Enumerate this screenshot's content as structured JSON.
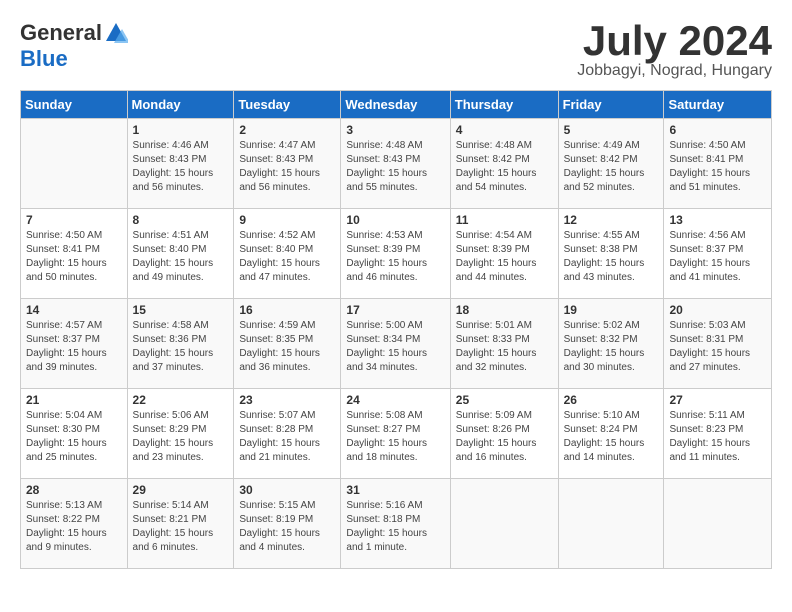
{
  "logo": {
    "general": "General",
    "blue": "Blue"
  },
  "title": "July 2024",
  "subtitle": "Jobbagyi, Nograd, Hungary",
  "days_of_week": [
    "Sunday",
    "Monday",
    "Tuesday",
    "Wednesday",
    "Thursday",
    "Friday",
    "Saturday"
  ],
  "weeks": [
    [
      {
        "day": "",
        "sunrise": "",
        "sunset": "",
        "daylight": ""
      },
      {
        "day": "1",
        "sunrise": "Sunrise: 4:46 AM",
        "sunset": "Sunset: 8:43 PM",
        "daylight": "Daylight: 15 hours and 56 minutes."
      },
      {
        "day": "2",
        "sunrise": "Sunrise: 4:47 AM",
        "sunset": "Sunset: 8:43 PM",
        "daylight": "Daylight: 15 hours and 56 minutes."
      },
      {
        "day": "3",
        "sunrise": "Sunrise: 4:48 AM",
        "sunset": "Sunset: 8:43 PM",
        "daylight": "Daylight: 15 hours and 55 minutes."
      },
      {
        "day": "4",
        "sunrise": "Sunrise: 4:48 AM",
        "sunset": "Sunset: 8:42 PM",
        "daylight": "Daylight: 15 hours and 54 minutes."
      },
      {
        "day": "5",
        "sunrise": "Sunrise: 4:49 AM",
        "sunset": "Sunset: 8:42 PM",
        "daylight": "Daylight: 15 hours and 52 minutes."
      },
      {
        "day": "6",
        "sunrise": "Sunrise: 4:50 AM",
        "sunset": "Sunset: 8:41 PM",
        "daylight": "Daylight: 15 hours and 51 minutes."
      }
    ],
    [
      {
        "day": "7",
        "sunrise": "Sunrise: 4:50 AM",
        "sunset": "Sunset: 8:41 PM",
        "daylight": "Daylight: 15 hours and 50 minutes."
      },
      {
        "day": "8",
        "sunrise": "Sunrise: 4:51 AM",
        "sunset": "Sunset: 8:40 PM",
        "daylight": "Daylight: 15 hours and 49 minutes."
      },
      {
        "day": "9",
        "sunrise": "Sunrise: 4:52 AM",
        "sunset": "Sunset: 8:40 PM",
        "daylight": "Daylight: 15 hours and 47 minutes."
      },
      {
        "day": "10",
        "sunrise": "Sunrise: 4:53 AM",
        "sunset": "Sunset: 8:39 PM",
        "daylight": "Daylight: 15 hours and 46 minutes."
      },
      {
        "day": "11",
        "sunrise": "Sunrise: 4:54 AM",
        "sunset": "Sunset: 8:39 PM",
        "daylight": "Daylight: 15 hours and 44 minutes."
      },
      {
        "day": "12",
        "sunrise": "Sunrise: 4:55 AM",
        "sunset": "Sunset: 8:38 PM",
        "daylight": "Daylight: 15 hours and 43 minutes."
      },
      {
        "day": "13",
        "sunrise": "Sunrise: 4:56 AM",
        "sunset": "Sunset: 8:37 PM",
        "daylight": "Daylight: 15 hours and 41 minutes."
      }
    ],
    [
      {
        "day": "14",
        "sunrise": "Sunrise: 4:57 AM",
        "sunset": "Sunset: 8:37 PM",
        "daylight": "Daylight: 15 hours and 39 minutes."
      },
      {
        "day": "15",
        "sunrise": "Sunrise: 4:58 AM",
        "sunset": "Sunset: 8:36 PM",
        "daylight": "Daylight: 15 hours and 37 minutes."
      },
      {
        "day": "16",
        "sunrise": "Sunrise: 4:59 AM",
        "sunset": "Sunset: 8:35 PM",
        "daylight": "Daylight: 15 hours and 36 minutes."
      },
      {
        "day": "17",
        "sunrise": "Sunrise: 5:00 AM",
        "sunset": "Sunset: 8:34 PM",
        "daylight": "Daylight: 15 hours and 34 minutes."
      },
      {
        "day": "18",
        "sunrise": "Sunrise: 5:01 AM",
        "sunset": "Sunset: 8:33 PM",
        "daylight": "Daylight: 15 hours and 32 minutes."
      },
      {
        "day": "19",
        "sunrise": "Sunrise: 5:02 AM",
        "sunset": "Sunset: 8:32 PM",
        "daylight": "Daylight: 15 hours and 30 minutes."
      },
      {
        "day": "20",
        "sunrise": "Sunrise: 5:03 AM",
        "sunset": "Sunset: 8:31 PM",
        "daylight": "Daylight: 15 hours and 27 minutes."
      }
    ],
    [
      {
        "day": "21",
        "sunrise": "Sunrise: 5:04 AM",
        "sunset": "Sunset: 8:30 PM",
        "daylight": "Daylight: 15 hours and 25 minutes."
      },
      {
        "day": "22",
        "sunrise": "Sunrise: 5:06 AM",
        "sunset": "Sunset: 8:29 PM",
        "daylight": "Daylight: 15 hours and 23 minutes."
      },
      {
        "day": "23",
        "sunrise": "Sunrise: 5:07 AM",
        "sunset": "Sunset: 8:28 PM",
        "daylight": "Daylight: 15 hours and 21 minutes."
      },
      {
        "day": "24",
        "sunrise": "Sunrise: 5:08 AM",
        "sunset": "Sunset: 8:27 PM",
        "daylight": "Daylight: 15 hours and 18 minutes."
      },
      {
        "day": "25",
        "sunrise": "Sunrise: 5:09 AM",
        "sunset": "Sunset: 8:26 PM",
        "daylight": "Daylight: 15 hours and 16 minutes."
      },
      {
        "day": "26",
        "sunrise": "Sunrise: 5:10 AM",
        "sunset": "Sunset: 8:24 PM",
        "daylight": "Daylight: 15 hours and 14 minutes."
      },
      {
        "day": "27",
        "sunrise": "Sunrise: 5:11 AM",
        "sunset": "Sunset: 8:23 PM",
        "daylight": "Daylight: 15 hours and 11 minutes."
      }
    ],
    [
      {
        "day": "28",
        "sunrise": "Sunrise: 5:13 AM",
        "sunset": "Sunset: 8:22 PM",
        "daylight": "Daylight: 15 hours and 9 minutes."
      },
      {
        "day": "29",
        "sunrise": "Sunrise: 5:14 AM",
        "sunset": "Sunset: 8:21 PM",
        "daylight": "Daylight: 15 hours and 6 minutes."
      },
      {
        "day": "30",
        "sunrise": "Sunrise: 5:15 AM",
        "sunset": "Sunset: 8:19 PM",
        "daylight": "Daylight: 15 hours and 4 minutes."
      },
      {
        "day": "31",
        "sunrise": "Sunrise: 5:16 AM",
        "sunset": "Sunset: 8:18 PM",
        "daylight": "Daylight: 15 hours and 1 minute."
      },
      {
        "day": "",
        "sunrise": "",
        "sunset": "",
        "daylight": ""
      },
      {
        "day": "",
        "sunrise": "",
        "sunset": "",
        "daylight": ""
      },
      {
        "day": "",
        "sunrise": "",
        "sunset": "",
        "daylight": ""
      }
    ]
  ]
}
